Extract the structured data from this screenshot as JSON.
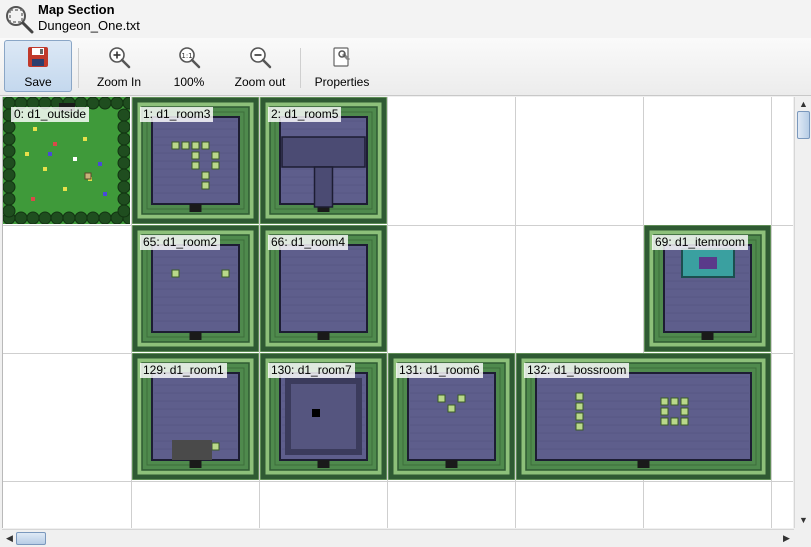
{
  "window": {
    "title": "Map Section",
    "subtitle": "Dungeon_One.txt",
    "icon": "magnifier-map-icon"
  },
  "toolbar": {
    "save_label": "Save",
    "zoom_in_label": "Zoom In",
    "zoom_reset_label": "100%",
    "zoom_out_label": "Zoom out",
    "properties_label": "Properties"
  },
  "map": {
    "rooms": [
      {
        "label": "0: d1_outside",
        "kind": "outside"
      },
      {
        "label": "1: d1_room3",
        "kind": "dungeon"
      },
      {
        "label": "2: d1_room5",
        "kind": "dungeon"
      },
      {
        "label": "65: d1_room2",
        "kind": "dungeon"
      },
      {
        "label": "66: d1_room4",
        "kind": "dungeon"
      },
      {
        "label": "69: d1_itemroom",
        "kind": "dungeon"
      },
      {
        "label": "129: d1_room1",
        "kind": "dungeon"
      },
      {
        "label": "130: d1_room7",
        "kind": "dungeon"
      },
      {
        "label": "131: d1_room6",
        "kind": "dungeon"
      },
      {
        "label": "132: d1_bossroom",
        "kind": "dungeon"
      }
    ]
  },
  "colors": {
    "wall_dark": "#2f5a33",
    "wall_mid": "#4f8a4d",
    "wall_light": "#8dc07a",
    "floor": "#5e5e8c",
    "floor_dark": "#4b4b73",
    "grass": "#3f9a3a",
    "grid": "#cfcfcf"
  }
}
